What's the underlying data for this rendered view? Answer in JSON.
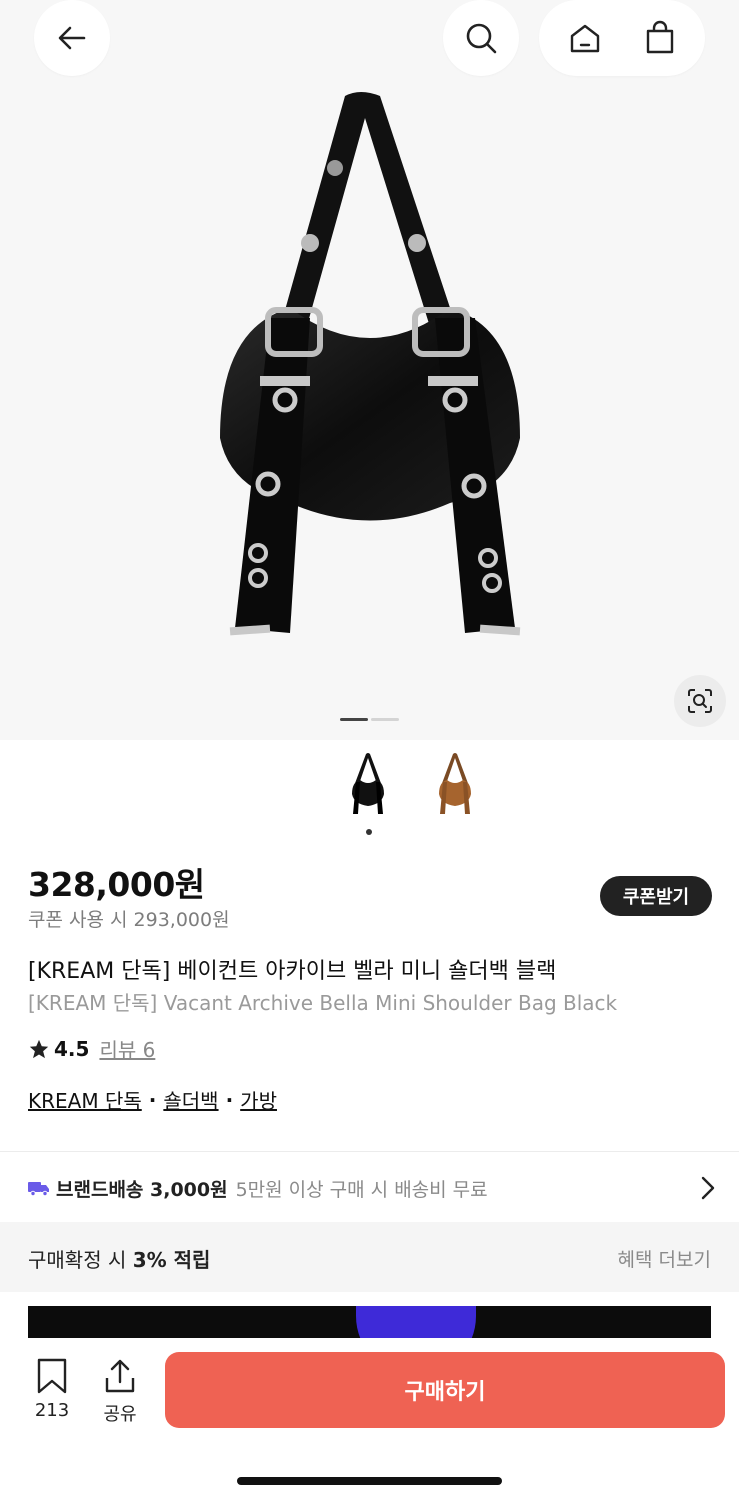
{
  "header": {
    "back_icon": "arrow-left-icon",
    "search_icon": "search-icon",
    "home_icon": "home-icon",
    "cart_icon": "shopping-bag-icon"
  },
  "gallery": {
    "page_count": 2,
    "current_page": 1,
    "thumbnails": [
      "black",
      "brown"
    ],
    "lens_icon": "image-search-icon"
  },
  "product": {
    "price": "328,000원",
    "coupon_price": "쿠폰 사용 시 293,000원",
    "coupon_button": "쿠폰받기",
    "title_ko": "[KREAM 단독] 베이컨트 아카이브 벨라 미니 숄더백 블랙",
    "title_en": "[KREAM 단독] Vacant Archive Bella Mini Shoulder Bag Black",
    "rating": "4.5",
    "review_label": "리뷰 6",
    "categories": [
      "KREAM 단독",
      "숄더백",
      "가방"
    ],
    "category_sep": "·"
  },
  "shipping": {
    "label": "브랜드배송 3,000원",
    "note": "5만원 이상 구매 시 배송비 무료"
  },
  "benefit": {
    "prefix": "구매확정 시 ",
    "highlight": "3% 적립",
    "more": "혜택 더보기"
  },
  "bottom_bar": {
    "bookmark_count": "213",
    "share_label": "공유",
    "buy_label": "구매하기"
  },
  "colors": {
    "accent": "#ef6253",
    "dark": "#222222",
    "shipping_icon": "#6a5be8"
  }
}
